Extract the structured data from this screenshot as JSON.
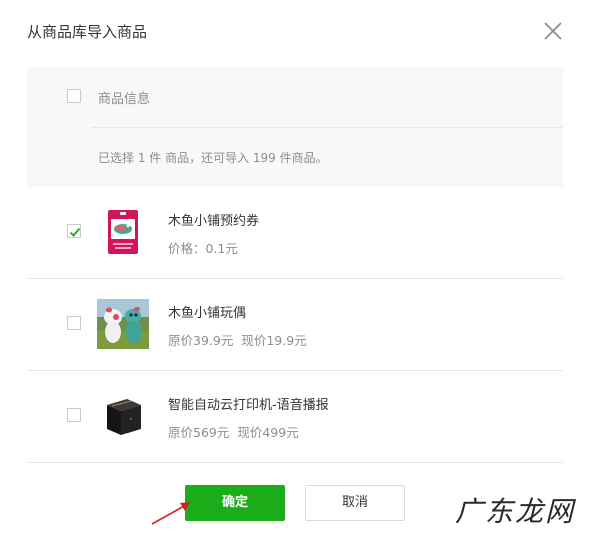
{
  "dialog": {
    "title": "从商品库导入商品",
    "close_icon": "close-icon"
  },
  "header": {
    "select_all_label": "商品信息",
    "selected_checked": false,
    "status_text": "已选择 1 件 商品，还可导入 199 件商品。"
  },
  "items": [
    {
      "name": "木鱼小铺预约券",
      "price_text": "价格：0.1元",
      "original_price": "",
      "current_price": "",
      "checked": true,
      "thumb_icon": "coupon-card-thumbnail"
    },
    {
      "name": "木鱼小铺玩偶",
      "price_text": "",
      "original_price": "原价39.9元",
      "current_price": "现价19.9元",
      "checked": false,
      "thumb_icon": "plush-toys-photo-thumbnail"
    },
    {
      "name": "智能自动云打印机-语音播报",
      "price_text": "",
      "original_price": "原价569元",
      "current_price": "现价499元",
      "checked": false,
      "thumb_icon": "black-printer-cube-thumbnail"
    }
  ],
  "footer": {
    "confirm_label": "确定",
    "cancel_label": "取消"
  },
  "watermark": {
    "text": "广东龙网"
  },
  "colors": {
    "accent_green": "#1aad19",
    "annotation_red": "#d6201c",
    "panel_bg": "#f6f8f9"
  }
}
